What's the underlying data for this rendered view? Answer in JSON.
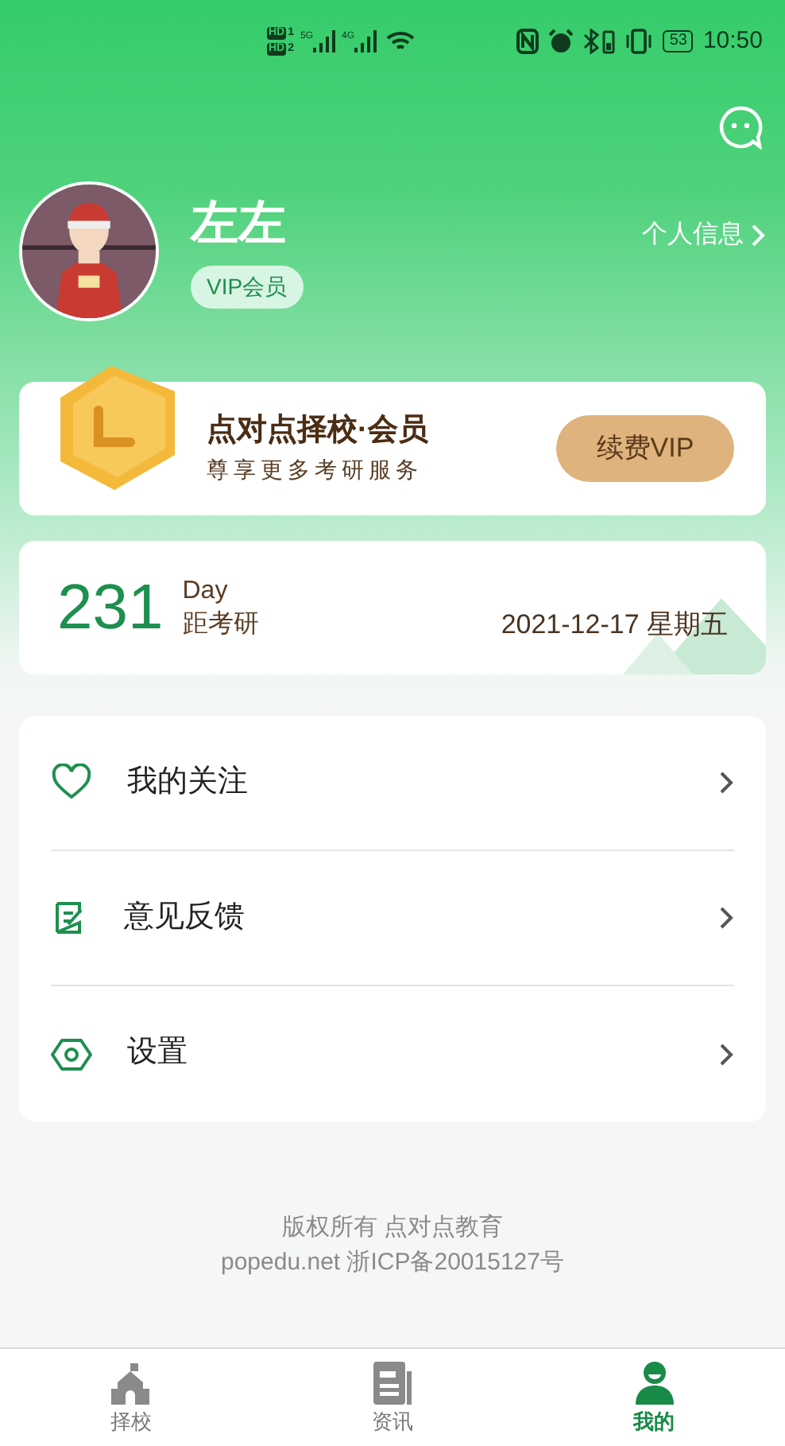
{
  "status_bar": {
    "hd_1": "HD",
    "sim_1": "1",
    "hd_2": "HD",
    "sim_2": "2",
    "network_1": "5G",
    "network_2": "4G",
    "battery": "53",
    "time": "10:50"
  },
  "profile": {
    "name": "左左",
    "badge": "VIP会员",
    "info_link": "个人信息"
  },
  "vip_card": {
    "title": "点对点择校·会员",
    "subtitle": "尊享更多考研服务",
    "button": "续费VIP"
  },
  "countdown": {
    "days": "231",
    "unit": "Day",
    "caption": "距考研",
    "date": "2021-12-17 星期五"
  },
  "menu": [
    {
      "kind": "heart",
      "label": "我的关注"
    },
    {
      "kind": "feedback",
      "label": "意见反馈"
    },
    {
      "kind": "settings",
      "label": "设置"
    }
  ],
  "footer": {
    "line_1": "版权所有 点对点教育",
    "line_2": "popedu.net 浙ICP备20015127号"
  },
  "tabs": [
    {
      "kind": "school",
      "label": "择校",
      "selected": false
    },
    {
      "kind": "news",
      "label": "资讯",
      "selected": false
    },
    {
      "kind": "profile",
      "label": "我的",
      "selected": true
    }
  ]
}
